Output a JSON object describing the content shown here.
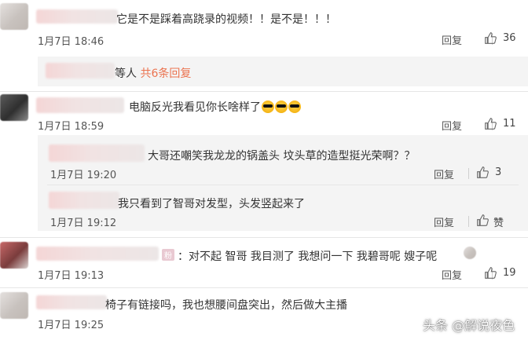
{
  "comments": [
    {
      "text": "它是不是踩着高跷录的视频！！是不是！！！",
      "date": "1月7日 18:46",
      "reply": "回复",
      "likes": "36"
    },
    {
      "more_prefix": "等人",
      "more_link": "共6条回复"
    },
    {
      "text": "电脑反光我看见你长啥样了",
      "date": "1月7日 18:59",
      "reply": "回复",
      "likes": "11",
      "emojis": [
        "sunglasses",
        "sunglasses",
        "sunglasses"
      ]
    },
    {
      "text": "大哥还嘲笑我龙龙的锅盖头 坟头草的造型挺光荣啊？？",
      "date": "1月7日 19:20",
      "reply": "回复",
      "likes": "3"
    },
    {
      "text": "我只看到了智哥对发型，头发竖起来了",
      "date": "1月7日 19:12",
      "reply": "回复",
      "likes": "赞"
    },
    {
      "badge": "粉",
      "text": "：对不起 智哥 我目测了 我想问一下 我碧哥呢 嫂子呢",
      "date": "1月7日 19:13",
      "reply": "回复",
      "likes": "19"
    },
    {
      "text": "椅子有链接吗，我也想腰间盘突出，然后做大主播",
      "date": "1月7日 19:25"
    }
  ],
  "watermark": "头条 @解说夜色",
  "icons": {
    "like": "thumbs-up-icon",
    "emoji": "sunglasses-emoji-icon"
  },
  "colors": {
    "link": "#eb7350",
    "reply_bg": "#f4f4f4",
    "text": "#333333"
  }
}
